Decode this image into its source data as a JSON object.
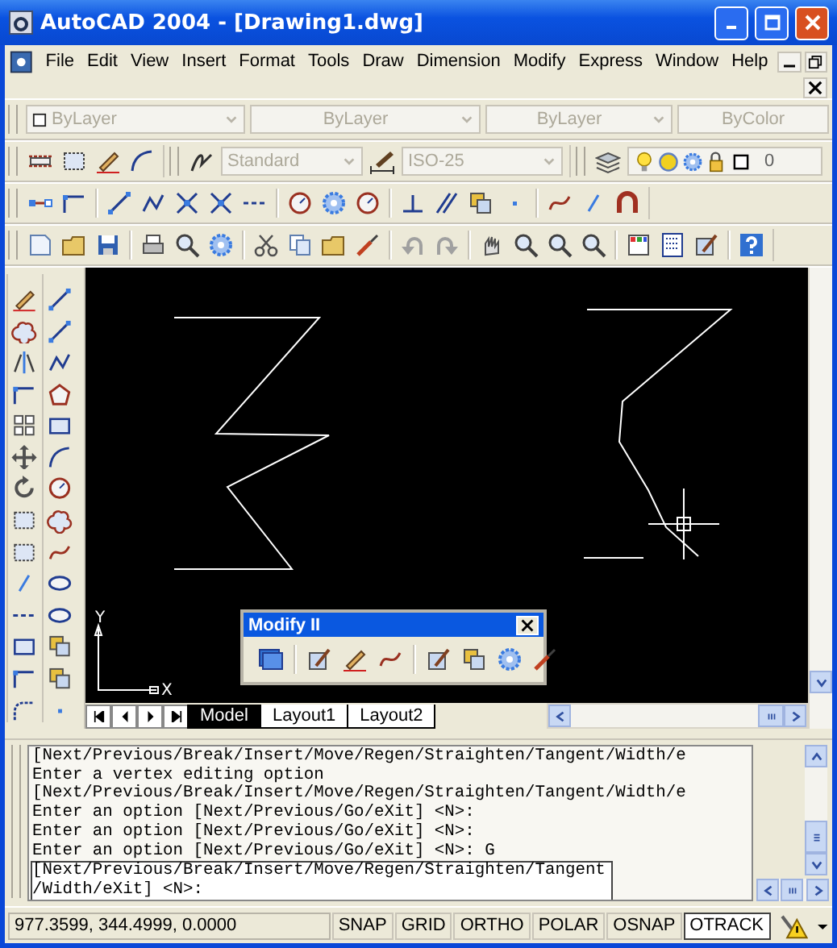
{
  "window": {
    "title": "AutoCAD 2004 - [Drawing1.dwg]"
  },
  "menu": [
    "File",
    "Edit",
    "View",
    "Insert",
    "Format",
    "Tools",
    "Draw",
    "Dimension",
    "Modify",
    "Express",
    "Window",
    "Help"
  ],
  "properties_toolbar": [
    {
      "value": "ByLayer",
      "disabled": true
    },
    {
      "value": "ByLayer",
      "disabled": true
    },
    {
      "value": "ByLayer",
      "disabled": true
    },
    {
      "value": "ByColor",
      "disabled": true
    }
  ],
  "styles_toolbar": {
    "text_style": "Standard",
    "dim_style": "ISO-25",
    "layer": "0"
  },
  "ucs": {
    "x_label": "X",
    "y_label": "Y"
  },
  "floating_toolbar": {
    "title": "Modify II"
  },
  "layout_tabs": [
    {
      "label": "Model",
      "selected": true
    },
    {
      "label": "Layout1",
      "selected": false
    },
    {
      "label": "Layout2",
      "selected": false
    }
  ],
  "command_history": [
    "[Next/Previous/Break/Insert/Move/Regen/Straighten/Tangent/Width/e",
    "Enter a vertex editing option",
    "[Next/Previous/Break/Insert/Move/Regen/Straighten/Tangent/Width/e",
    "Enter an option [Next/Previous/Go/eXit] <N>:",
    "Enter an option [Next/Previous/Go/eXit] <N>:",
    "Enter an option [Next/Previous/Go/eXit] <N>: G"
  ],
  "command_prompt": [
    "[Next/Previous/Break/Insert/Move/Regen/Straighten/Tangent",
    "/Width/eXit] <N>:"
  ],
  "status_bar": {
    "coordinates": "977.3599, 344.4999, 0.0000",
    "toggles": [
      {
        "label": "SNAP",
        "on": false
      },
      {
        "label": "GRID",
        "on": false
      },
      {
        "label": "ORTHO",
        "on": false
      },
      {
        "label": "POLAR",
        "on": false
      },
      {
        "label": "OSNAP",
        "on": false
      },
      {
        "label": "OTRACK",
        "on": true
      }
    ]
  }
}
